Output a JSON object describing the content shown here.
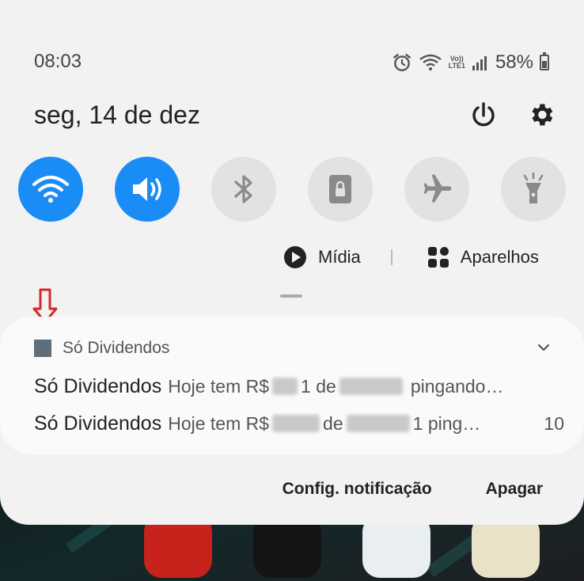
{
  "status_bar": {
    "time": "08:03",
    "lte_top": "Vo))",
    "lte_bottom": "LTE1",
    "battery_percent": "58%",
    "battery_level": 0.58
  },
  "header": {
    "date": "seg, 14 de dez"
  },
  "quick_tiles": [
    {
      "id": "wifi",
      "icon": "wifi-icon",
      "active": true
    },
    {
      "id": "sound",
      "icon": "volume-icon",
      "active": true
    },
    {
      "id": "bluetooth",
      "icon": "bluetooth-icon",
      "active": false
    },
    {
      "id": "rotation-lock",
      "icon": "rotation-lock-icon",
      "active": false
    },
    {
      "id": "airplane",
      "icon": "airplane-icon",
      "active": false
    },
    {
      "id": "flashlight",
      "icon": "flashlight-icon",
      "active": false
    }
  ],
  "media_row": {
    "media_label": "Mídia",
    "devices_label": "Aparelhos"
  },
  "notification_card": {
    "app_name": "Só Dividendos",
    "items": [
      {
        "sender": "Só Dividendos",
        "body_start": "Hoje tem R$",
        "body_mid": "1 de",
        "body_end": "pingando…",
        "count": ""
      },
      {
        "sender": "Só Dividendos",
        "body_start": "Hoje tem R$",
        "body_mid": "de",
        "body_end": "1 ping…",
        "count": "10"
      }
    ]
  },
  "footer": {
    "settings_label": "Config. notificação",
    "clear_label": "Apagar"
  },
  "colors": {
    "tile_active": "#1a8cf6",
    "tile_inactive": "#e2e2e2",
    "annotation_arrow": "#d9262b"
  }
}
